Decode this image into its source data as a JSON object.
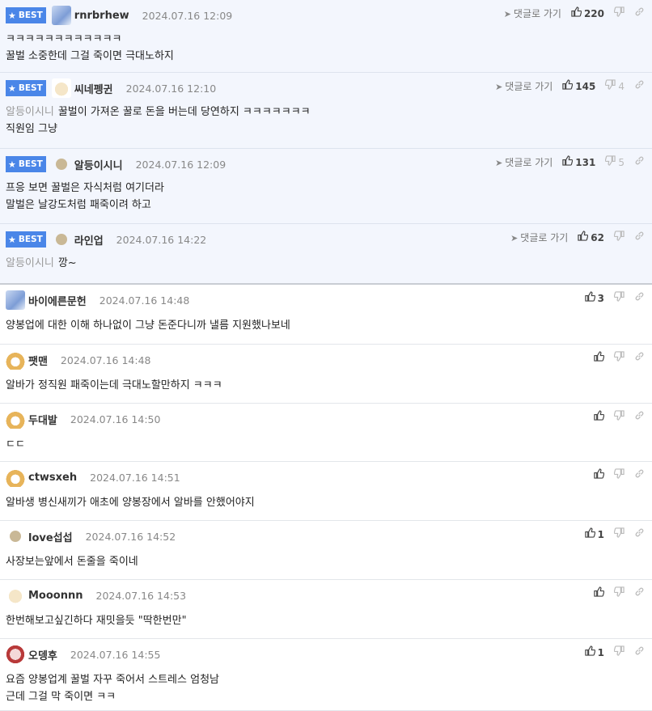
{
  "reply_label": "댓글로 가기",
  "best_label": "BEST",
  "comments": [
    {
      "best": true,
      "avatar": "blue",
      "nick": "rnrbrhew",
      "date": "2024.07.16 12:09",
      "up": "220",
      "down": "",
      "lines": [
        "ㅋㅋㅋㅋㅋㅋㅋㅋㅋㅋㅋㅋ",
        "꿀벌 소중한데 그걸 죽이면 극대노하지"
      ]
    },
    {
      "best": true,
      "avatar": "pup",
      "nick": "씨네펭귄",
      "date": "2024.07.16 12:10",
      "up": "145",
      "down": "4",
      "mention": "알등이시니",
      "lines": [
        "꿀벌이 가져온 꿀로 돈을 버는데 당연하지 ㅋㅋㅋㅋㅋㅋㅋ",
        "직원임 그냥"
      ]
    },
    {
      "best": true,
      "avatar": "dot",
      "nick": "알등이시니",
      "date": "2024.07.16 12:09",
      "up": "131",
      "down": "5",
      "lines": [
        "프응 보면 꿀벌은 자식처럼 여기더라",
        "말벌은 날강도처럼 패죽이려 하고"
      ]
    },
    {
      "best": true,
      "avatar": "dot",
      "nick": "라인업",
      "date": "2024.07.16 14:22",
      "up": "62",
      "down": "",
      "mention": "알등이시니",
      "lines": [
        "깡~"
      ]
    },
    {
      "best": false,
      "avatar": "blue",
      "nick": "바이에른문헌",
      "date": "2024.07.16 14:48",
      "up": "3",
      "down": "",
      "lines": [
        "양봉업에 대한 이해 하나없이 그냥 돈준다니까 낼름 지원했나보네"
      ]
    },
    {
      "best": false,
      "avatar": "fox",
      "nick": "팻맨",
      "date": "2024.07.16 14:48",
      "up": "",
      "down": "",
      "lines": [
        "알바가 정직원 패죽이는데 극대노할만하지 ㅋㅋㅋ"
      ]
    },
    {
      "best": false,
      "avatar": "fox",
      "nick": "두대발",
      "date": "2024.07.16 14:50",
      "up": "",
      "down": "",
      "lines": [
        "ㄷㄷ"
      ]
    },
    {
      "best": false,
      "avatar": "fox",
      "nick": "ctwsxeh",
      "date": "2024.07.16 14:51",
      "up": "",
      "down": "",
      "lines": [
        "알바생 병신새끼가 애초에 양봉장에서 알바를 안했어야지"
      ]
    },
    {
      "best": false,
      "avatar": "dot",
      "nick": "love섭섭",
      "date": "2024.07.16 14:52",
      "up": "1",
      "down": "",
      "lines": [
        "사장보는앞에서 돈줄을 죽이네"
      ]
    },
    {
      "best": false,
      "avatar": "pup",
      "nick": "Mooonnn",
      "date": "2024.07.16 14:53",
      "up": "",
      "down": "",
      "lines": [
        "한번해보고싶긴하다 재밋을듯 \"딱한번만\""
      ]
    },
    {
      "best": false,
      "avatar": "red",
      "nick": "오뎅후",
      "date": "2024.07.16 14:55",
      "up": "1",
      "down": "",
      "lines": [
        "요즘 양봉업계 꿀벌 자꾸 죽어서 스트레스 엄청남",
        "근데 그걸 막 죽이면 ㅋㅋ"
      ]
    }
  ]
}
